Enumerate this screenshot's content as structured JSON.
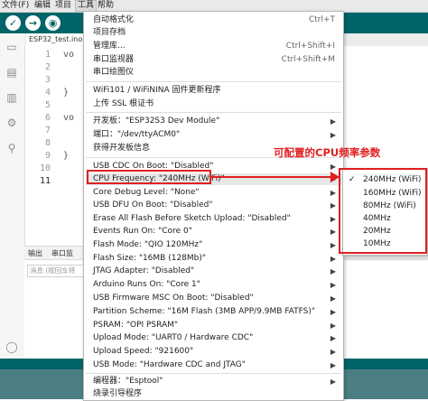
{
  "menubar": {
    "items": [
      "文件(F)",
      "编辑",
      "项目",
      "工具",
      "帮助"
    ]
  },
  "toolbar": {
    "verify_glyph": "✓",
    "upload_glyph": "→",
    "debug_glyph": "◉"
  },
  "editor": {
    "file_tab": "ESP32_test.ino",
    "line_numbers": [
      "1",
      "2",
      "3",
      "4",
      "5",
      "6",
      "7",
      "8",
      "9",
      "10",
      "11"
    ],
    "current_line": "11",
    "code_fragments": {
      "void1": "vo",
      "brace1": "}",
      "void2": "vo",
      "brace2": "}"
    }
  },
  "bottom_panel": {
    "tabs": [
      "输出",
      "串口监"
    ],
    "input_placeholder": "消息 (按回车将"
  },
  "tools_menu": {
    "items": [
      {
        "label": "自动格式化",
        "shortcut": "Ctrl+T"
      },
      {
        "label": "项目存档",
        "shortcut": ""
      },
      {
        "label": "管理库...",
        "shortcut": "Ctrl+Shift+I"
      },
      {
        "label": "串口监视器",
        "shortcut": "Ctrl+Shift+M"
      },
      {
        "label": "串口绘图仪",
        "shortcut": ""
      },
      {
        "label": "WiFi101 / WiFiNINA 固件更新程序",
        "shortcut": ""
      },
      {
        "label": "上传 SSL 根证书",
        "shortcut": ""
      },
      {
        "label": "开发板：\"ESP32S3 Dev Module\"",
        "shortcut": ""
      },
      {
        "label": "端口：\"/dev/ttyACM0\"",
        "shortcut": ""
      },
      {
        "label": "获得开发板信息",
        "shortcut": ""
      },
      {
        "label": "USB CDC On Boot: \"Disabled\"",
        "shortcut": ""
      },
      {
        "label": "CPU Frequency: \"240MHz (WiFi)\"",
        "shortcut": ""
      },
      {
        "label": "Core Debug Level: \"None\"",
        "shortcut": ""
      },
      {
        "label": "USB DFU On Boot: \"Disabled\"",
        "shortcut": ""
      },
      {
        "label": "Erase All Flash Before Sketch Upload: \"Disabled\"",
        "shortcut": ""
      },
      {
        "label": "Events Run On: \"Core 0\"",
        "shortcut": ""
      },
      {
        "label": "Flash Mode: \"QIO 120MHz\"",
        "shortcut": ""
      },
      {
        "label": "Flash Size: \"16MB (128Mb)\"",
        "shortcut": ""
      },
      {
        "label": "JTAG Adapter: \"Disabled\"",
        "shortcut": ""
      },
      {
        "label": "Arduino Runs On: \"Core 1\"",
        "shortcut": ""
      },
      {
        "label": "USB Firmware MSC On Boot: \"Disabled\"",
        "shortcut": ""
      },
      {
        "label": "Partition Scheme: \"16M Flash (3MB APP/9.9MB FATFS)\"",
        "shortcut": ""
      },
      {
        "label": "PSRAM: \"OPI PSRAM\"",
        "shortcut": ""
      },
      {
        "label": "Upload Mode: \"UART0 / Hardware CDC\"",
        "shortcut": ""
      },
      {
        "label": "Upload Speed: \"921600\"",
        "shortcut": ""
      },
      {
        "label": "USB Mode: \"Hardware CDC and JTAG\"",
        "shortcut": ""
      },
      {
        "label": "编程器：\"Esptool\"",
        "shortcut": ""
      },
      {
        "label": "烧录引导程序",
        "shortcut": ""
      }
    ]
  },
  "cpu_submenu": {
    "checkmark": "✓",
    "options": [
      "240MHz (WiFi)",
      "160MHz (WiFi)",
      "80MHz (WiFi)",
      "40MHz",
      "20MHz",
      "10MHz"
    ],
    "selected": "240MHz (WiFi)"
  },
  "annotation": {
    "text": "可配置的CPU频率参数",
    "color": "#e02020"
  },
  "colors": {
    "toolbar": "#006468",
    "accent_red": "#e02020",
    "status_bar": "#4b7f83"
  }
}
